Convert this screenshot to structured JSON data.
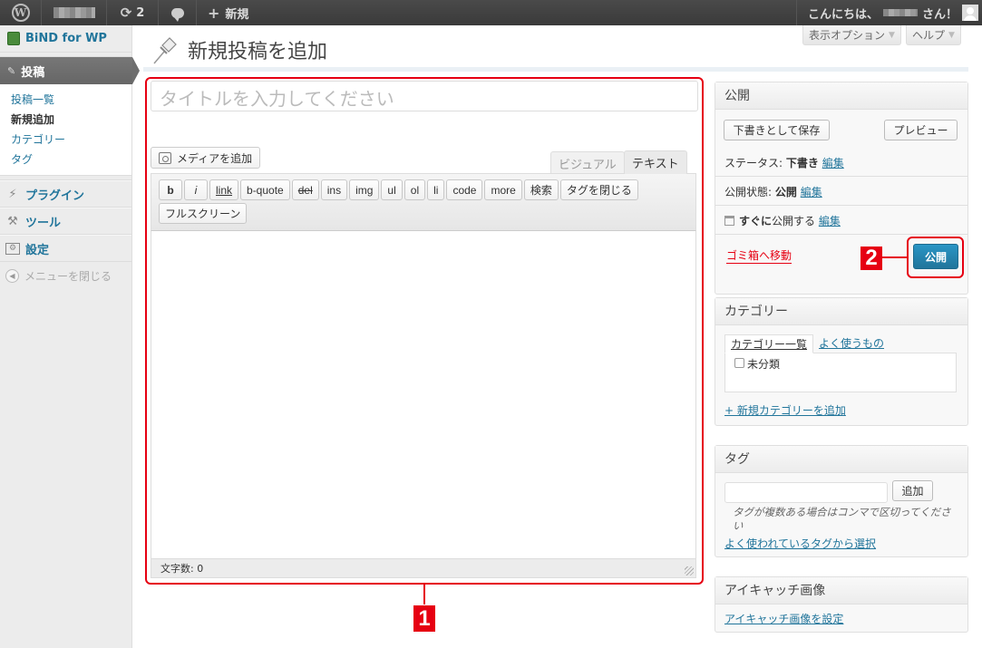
{
  "adminbar": {
    "updates_count": "2",
    "new_label": "新規",
    "greeting_prefix": "こんにちは、",
    "greeting_suffix": "さん！"
  },
  "screen_options": {
    "display_options": "表示オプション",
    "help": "ヘルプ"
  },
  "sidebar": {
    "brand": "BiND for WP",
    "posts": "投稿",
    "posts_sub": [
      "投稿一覧",
      "新規追加",
      "カテゴリー",
      "タグ"
    ],
    "items": [
      {
        "label": "プラグイン",
        "icon": "plugin-icon"
      },
      {
        "label": "ツール",
        "icon": "tools-icon"
      },
      {
        "label": "設定",
        "icon": "settings-icon"
      }
    ],
    "collapse": "メニューを閉じる"
  },
  "page": {
    "title": "新規投稿を追加"
  },
  "editor": {
    "title_placeholder": "タイトルを入力してください",
    "add_media": "メディアを追加",
    "tab_visual": "ビジュアル",
    "tab_text": "テキスト",
    "quicktags": [
      "b",
      "i",
      "link",
      "b-quote",
      "del",
      "ins",
      "img",
      "ul",
      "ol",
      "li",
      "code",
      "more",
      "検索",
      "タグを閉じる",
      "フルスクリーン"
    ],
    "word_count": "文字数: 0"
  },
  "callouts": {
    "one": "1",
    "two": "2"
  },
  "publish_box": {
    "title": "公開",
    "save_draft": "下書きとして保存",
    "preview": "プレビュー",
    "status_label": "ステータス:",
    "status_value": "下書き",
    "visibility_label": "公開状態:",
    "visibility_value": "公開",
    "schedule_bold": "すぐに",
    "schedule_text": "公開する",
    "edit": "編集",
    "trash": "ゴミ箱へ移動",
    "publish": "公開"
  },
  "category_box": {
    "title": "カテゴリー",
    "tab_all": "カテゴリー一覧",
    "tab_popular": "よく使うもの",
    "items": [
      "未分類"
    ],
    "add_new": "+ 新規カテゴリーを追加"
  },
  "tag_box": {
    "title": "タグ",
    "add": "追加",
    "hint": "タグが複数ある場合はコンマで区切ってください",
    "choose_popular": "よく使われているタグから選択"
  },
  "featured_box": {
    "title": "アイキャッチ画像",
    "set": "アイキャッチ画像を設定"
  },
  "colors": {
    "accent_link": "#21759b",
    "callout_red": "#e60012",
    "adminbar_bg": "#464646"
  }
}
